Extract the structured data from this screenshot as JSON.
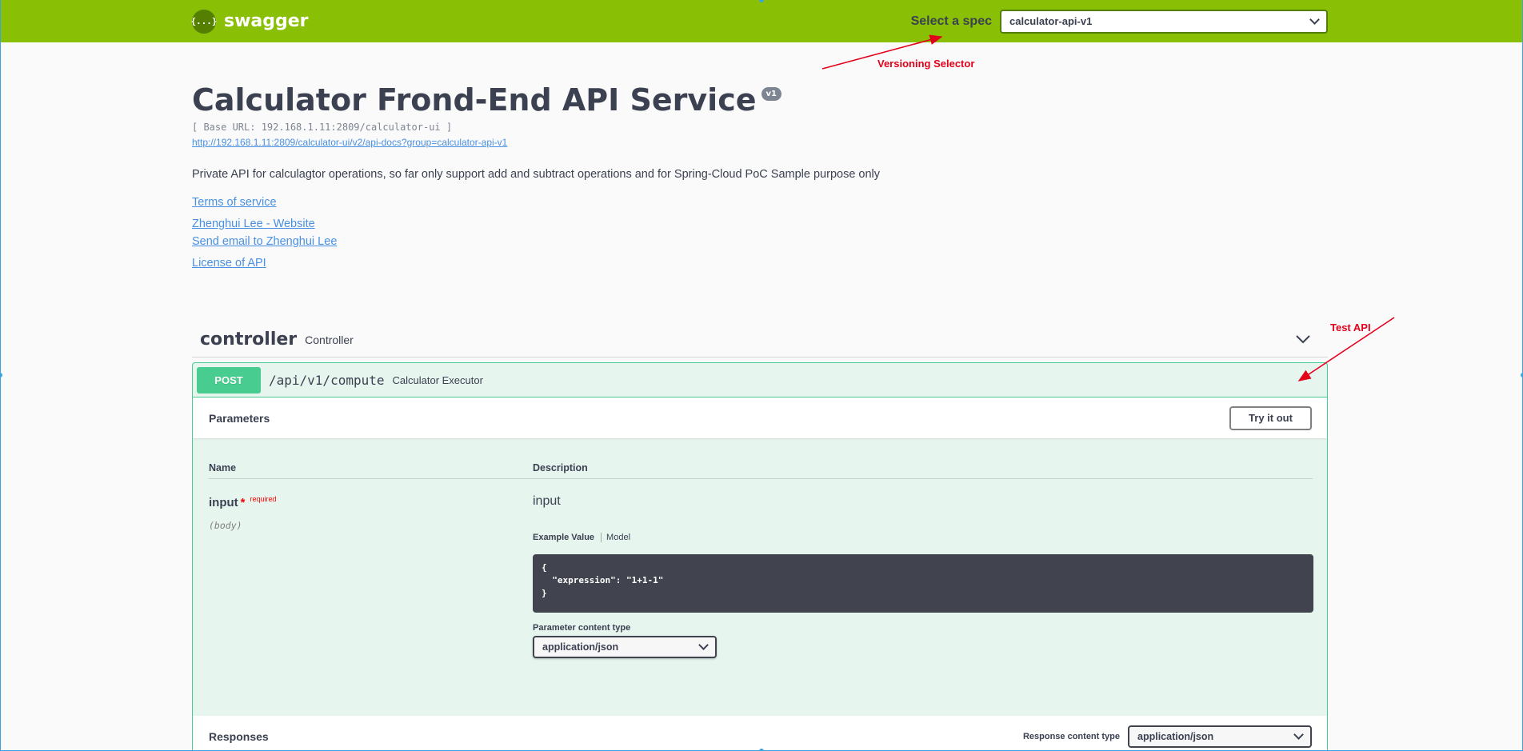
{
  "topbar": {
    "logo_text": "swagger",
    "logo_icon": "{...}",
    "spec_label": "Select a spec",
    "spec_value": "calculator-api-v1"
  },
  "info": {
    "title": "Calculator Frond-End API Service",
    "version": "v1",
    "base_url": "[ Base URL: 192.168.1.11:2809/calculator-ui ]",
    "doc_link": "http://192.168.1.11:2809/calculator-ui/v2/api-docs?group=calculator-api-v1",
    "description": "Private API for calculagtor operations, so far only support add and subtract operations and for Spring-Cloud PoC Sample purpose only",
    "links": {
      "terms": "Terms of service",
      "website": "Zhenghui Lee - Website",
      "email": "Send email to Zhenghui Lee",
      "license": "License of API"
    }
  },
  "tag": {
    "name": "controller",
    "description": "Controller"
  },
  "operation": {
    "method": "POST",
    "path": "/api/v1/compute",
    "summary": "Calculator Executor",
    "parameters_title": "Parameters",
    "try_button": "Try it out",
    "col_name": "Name",
    "col_description": "Description",
    "param": {
      "name": "input",
      "star": "*",
      "required": "required",
      "in": "(body)",
      "description": "input",
      "tab_example": "Example Value",
      "tab_model": "Model",
      "example": "{\n  \"expression\": \"1+1-1\"\n}",
      "content_type_label": "Parameter content type",
      "content_type_value": "application/json"
    },
    "responses_title": "Responses",
    "response_content_type_label": "Response content type",
    "response_content_type_value": "application/json"
  },
  "annotations": {
    "versioning": "Versioning Selector",
    "test_api": "Test API",
    "color": "#e3001b"
  },
  "colors": {
    "topbar": "#89bf04",
    "post": "#49cc90",
    "link": "#4990e2",
    "text": "#3b4151"
  }
}
